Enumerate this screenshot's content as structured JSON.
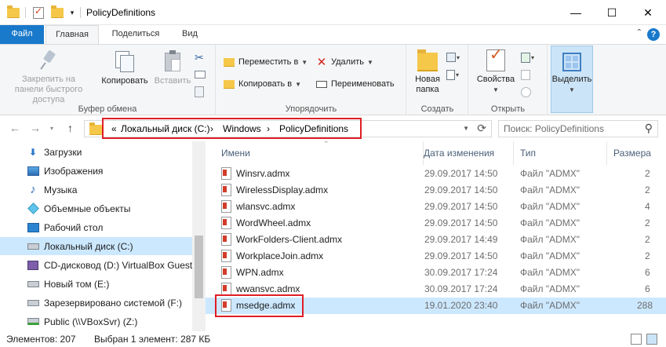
{
  "window": {
    "title": "PolicyDefinitions",
    "minimize": "—",
    "maximize": "☐",
    "close": "✕"
  },
  "tabs": [
    {
      "label": "Файл"
    },
    {
      "label": "Главная"
    },
    {
      "label": "Поделиться"
    },
    {
      "label": "Вид"
    }
  ],
  "ribbon": {
    "clipboard": {
      "label": "Буфер обмена",
      "pin": "Закрепить на панели быстрого доступа",
      "copy": "Копировать",
      "paste": "Вставить"
    },
    "organize": {
      "label": "Упорядочить",
      "move_to": "Переместить в",
      "copy_to": "Копировать в",
      "delete": "Удалить",
      "rename": "Переименовать"
    },
    "new": {
      "label": "Создать",
      "new_folder": "Новая папка"
    },
    "open": {
      "label": "Открыть",
      "properties": "Свойства"
    },
    "select": {
      "label": "Выделить"
    }
  },
  "address": {
    "prefix": "«",
    "crumbs": [
      "Локальный диск (C:)",
      "Windows",
      "PolicyDefinitions"
    ],
    "separator": "›"
  },
  "search": {
    "placeholder": "Поиск: PolicyDefinitions"
  },
  "nav": {
    "items": [
      {
        "label": "Загрузки",
        "icon": "download-icon"
      },
      {
        "label": "Изображения",
        "icon": "pictures-icon"
      },
      {
        "label": "Музыка",
        "icon": "music-icon"
      },
      {
        "label": "Объемные объекты",
        "icon": "3d-objects-icon"
      },
      {
        "label": "Рабочий стол",
        "icon": "desktop-icon"
      },
      {
        "label": "Локальный диск (C:)",
        "icon": "drive-icon",
        "selected": true
      },
      {
        "label": "CD-дисковод (D:) VirtualBox Guest A",
        "icon": "cd-drive-icon"
      },
      {
        "label": "Новый том (E:)",
        "icon": "drive-icon"
      },
      {
        "label": "Зарезервировано системой (F:)",
        "icon": "drive-icon"
      },
      {
        "label": "Public (\\\\VBoxSvr) (Z:)",
        "icon": "network-drive-icon"
      }
    ]
  },
  "columns": {
    "name": "Имени",
    "date": "Дата изменения",
    "type": "Тип",
    "size": "Размера"
  },
  "files": [
    {
      "name": "Winsrv.admx",
      "date": "29.09.2017 14:50",
      "type": "Файл \"ADMX\"",
      "size": "2"
    },
    {
      "name": "WirelessDisplay.admx",
      "date": "29.09.2017 14:50",
      "type": "Файл \"ADMX\"",
      "size": "2"
    },
    {
      "name": "wlansvc.admx",
      "date": "29.09.2017 14:50",
      "type": "Файл \"ADMX\"",
      "size": "4"
    },
    {
      "name": "WordWheel.admx",
      "date": "29.09.2017 14:50",
      "type": "Файл \"ADMX\"",
      "size": "2"
    },
    {
      "name": "WorkFolders-Client.admx",
      "date": "29.09.2017 14:49",
      "type": "Файл \"ADMX\"",
      "size": "2"
    },
    {
      "name": "WorkplaceJoin.admx",
      "date": "29.09.2017 14:50",
      "type": "Файл \"ADMX\"",
      "size": "2"
    },
    {
      "name": "WPN.admx",
      "date": "30.09.2017 17:24",
      "type": "Файл \"ADMX\"",
      "size": "6"
    },
    {
      "name": "wwansvc.admx",
      "date": "30.09.2017 17:24",
      "type": "Файл \"ADMX\"",
      "size": "6"
    },
    {
      "name": "msedge.admx",
      "date": "19.01.2020 23:40",
      "type": "Файл \"ADMX\"",
      "size": "288",
      "selected": true
    }
  ],
  "status": {
    "count": "Элементов: 207",
    "selection": "Выбран 1 элемент: 287 КБ"
  }
}
